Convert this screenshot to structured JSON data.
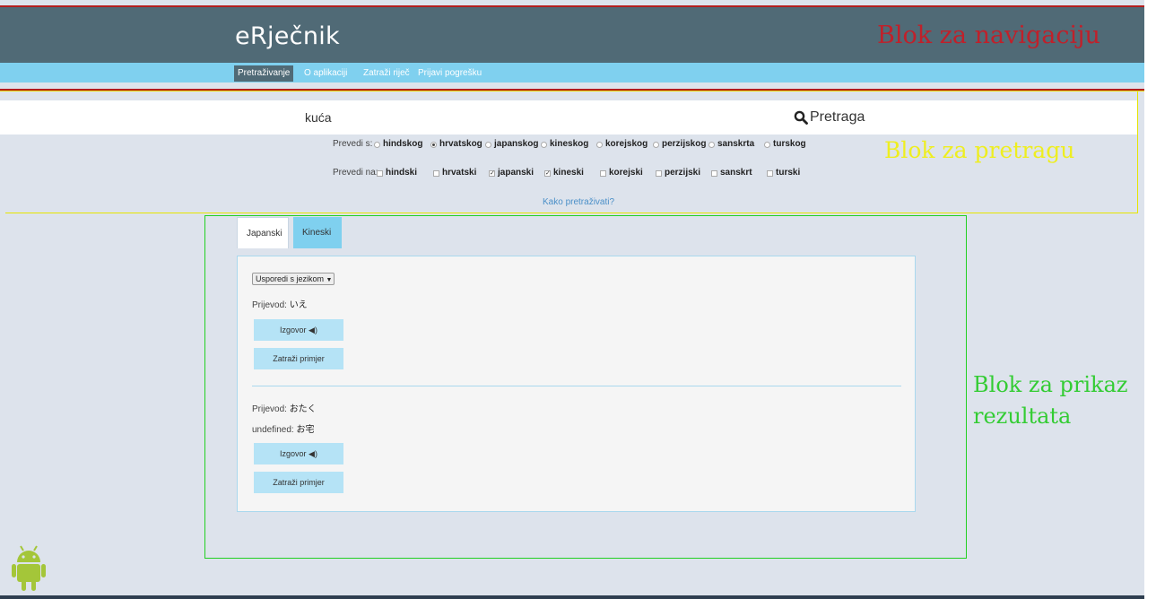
{
  "app": {
    "title": "eRječnik"
  },
  "annotations": {
    "navigation": "Blok za navigaciju",
    "search": "Blok za pretragu",
    "results_line1": "Blok za prikaz",
    "results_line2": "rezultata"
  },
  "nav": {
    "items": [
      {
        "label": "Pretraživanje",
        "active": true
      },
      {
        "label": "O aplikaciji",
        "active": false
      },
      {
        "label": "Zatraži riječ",
        "active": false
      },
      {
        "label": "Prijavi pogrešku",
        "active": false
      }
    ]
  },
  "search": {
    "value": "kuća",
    "button_label": "Pretraga",
    "from_label": "Prevedi s:",
    "from_options": [
      {
        "label": "hindskog",
        "selected": false
      },
      {
        "label": "hrvatskog",
        "selected": true
      },
      {
        "label": "japanskog",
        "selected": false
      },
      {
        "label": "kineskog",
        "selected": false
      },
      {
        "label": "korejskog",
        "selected": false
      },
      {
        "label": "perzijskog",
        "selected": false
      },
      {
        "label": "sanskrta",
        "selected": false
      },
      {
        "label": "turskog",
        "selected": false
      }
    ],
    "to_label": "Prevedi na:",
    "to_options": [
      {
        "label": "hindski",
        "checked": false
      },
      {
        "label": "hrvatski",
        "checked": false
      },
      {
        "label": "japanski",
        "checked": true
      },
      {
        "label": "kineski",
        "checked": true
      },
      {
        "label": "korejski",
        "checked": false
      },
      {
        "label": "perzijski",
        "checked": false
      },
      {
        "label": "sanskrt",
        "checked": false
      },
      {
        "label": "turski",
        "checked": false
      }
    ],
    "help_link": "Kako pretraživati?"
  },
  "results": {
    "tabs": [
      {
        "label": "Japanski",
        "active": true
      },
      {
        "label": "Kineski",
        "active": false
      }
    ],
    "compare_select": "Usporedi s jezikom",
    "entries": [
      {
        "label": "Prijevod:",
        "translation": "いえ",
        "pronounce_button": "Izgovor",
        "example_button": "Zatraži primjer"
      },
      {
        "label": "Prijevod:",
        "translation": "おたく",
        "extra_label": "undefined:",
        "extra_value": "お宅",
        "pronounce_button": "Izgovor",
        "example_button": "Zatraži primjer"
      }
    ]
  },
  "colors": {
    "header": "#506a76",
    "navbar": "#7fd0ef",
    "page_bg": "#dde3ec",
    "button_bg": "#b5e3f6",
    "annotation_red": "#c0202a",
    "annotation_yellow": "#eeee20",
    "annotation_green": "#33cc33"
  },
  "icons": {
    "search": "magnifier-icon",
    "speaker": "speaker-icon",
    "android": "android-icon",
    "dropdown": "triangle-down-icon"
  }
}
